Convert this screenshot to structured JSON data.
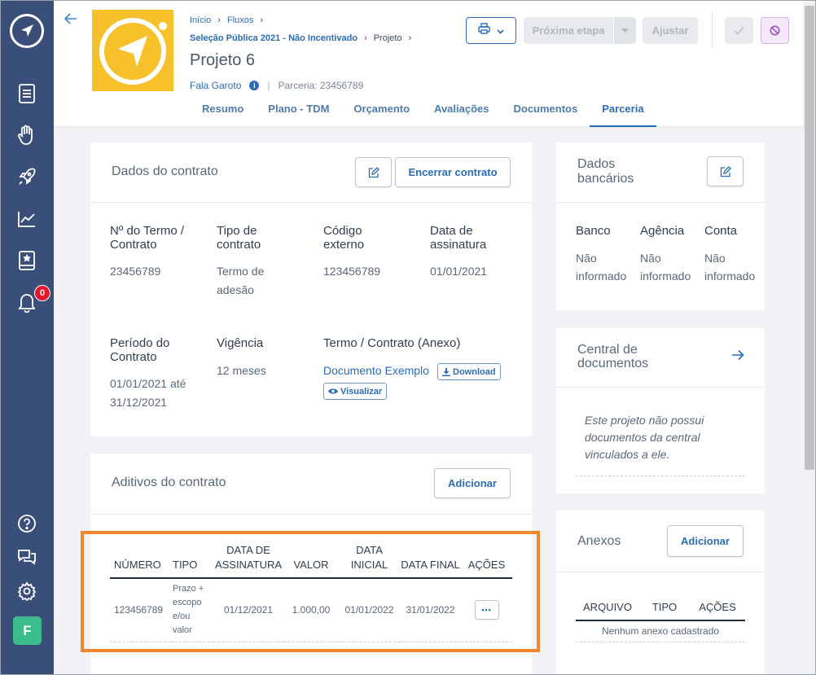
{
  "sidebar": {
    "logo_icon": "send-arrow-icon",
    "items": [
      {
        "name": "document-list-icon"
      },
      {
        "name": "hand-heart-icon"
      },
      {
        "name": "rocket-icon"
      },
      {
        "name": "chart-line-icon"
      },
      {
        "name": "book-star-icon"
      },
      {
        "name": "bell-icon"
      }
    ],
    "notification_count": "0",
    "bottom": [
      {
        "name": "help-icon"
      },
      {
        "name": "chat-icon"
      },
      {
        "name": "settings-icon"
      }
    ],
    "avatar_letter": "F",
    "bg_color": "#3a4e7a",
    "avatar_color": "#3cbc8d"
  },
  "header": {
    "breadcrumb": {
      "home": "Início",
      "flows": "Fluxos",
      "selection": "Seleção Pública 2021 - Não Incentivado",
      "current": "Projeto"
    },
    "title": "Projeto 6",
    "org": "Fala Garoto",
    "partnership": "Parceria: 23456789",
    "tabs": [
      "Resumo",
      "Plano - TDM",
      "Orçamento",
      "Avaliações",
      "Documentos",
      "Parceria"
    ],
    "active_tab": "Parceria",
    "buttons": {
      "next_step": "Próxima etapa",
      "adjust": "Ajustar"
    },
    "logo_color": "#f6c12b"
  },
  "contract": {
    "title": "Dados do contrato",
    "end_button": "Encerrar contrato",
    "fields": {
      "term_number_label": "Nº do Termo / Contrato",
      "term_number_value": "23456789",
      "type_label": "Tipo de contrato",
      "type_value": "Termo de adesão",
      "external_code_label": "Código externo",
      "external_code_value": "123456789",
      "signature_date_label": "Data de assinatura",
      "signature_date_value": "01/01/2021",
      "period_label": "Período do Contrato",
      "period_value": "01/01/2021 até 31/12/2021",
      "validity_label": "Vigência",
      "validity_value": "12 meses",
      "attachment_label": "Termo / Contrato (Anexo)",
      "attachment_link": "Documento Exemplo",
      "download": "Download",
      "view": "Visualizar"
    }
  },
  "amendments": {
    "title": "Aditivos do contrato",
    "add_button": "Adicionar",
    "columns": [
      "NÚMERO",
      "TIPO",
      "DATA DE ASSINATURA",
      "VALOR",
      "DATA INICIAL",
      "DATA FINAL",
      "AÇÕES"
    ],
    "rows": [
      {
        "number": "123456789",
        "type": "Prazo + escopo e/ou valor",
        "signature_date": "01/12/2021",
        "value": "1.000,00",
        "start_date": "01/01/2022",
        "end_date": "31/01/2022",
        "actions": "•••"
      }
    ]
  },
  "bank": {
    "title": "Dados bancários",
    "bank_label": "Banco",
    "agency_label": "Agência",
    "account_label": "Conta",
    "bank_value": "Não informado",
    "agency_value": "Não informado",
    "account_value": "Não informado"
  },
  "central_docs": {
    "title": "Central de documentos",
    "empty_text": "Este projeto não possui documentos da central vinculados a ele."
  },
  "attachments": {
    "title": "Anexos",
    "add_button": "Adicionar",
    "columns": [
      "ARQUIVO",
      "TIPO",
      "AÇÕES"
    ],
    "empty_text": "Nenhum anexo cadastrado"
  },
  "colors": {
    "primary": "#2a6db4",
    "highlight": "#f2862a"
  }
}
